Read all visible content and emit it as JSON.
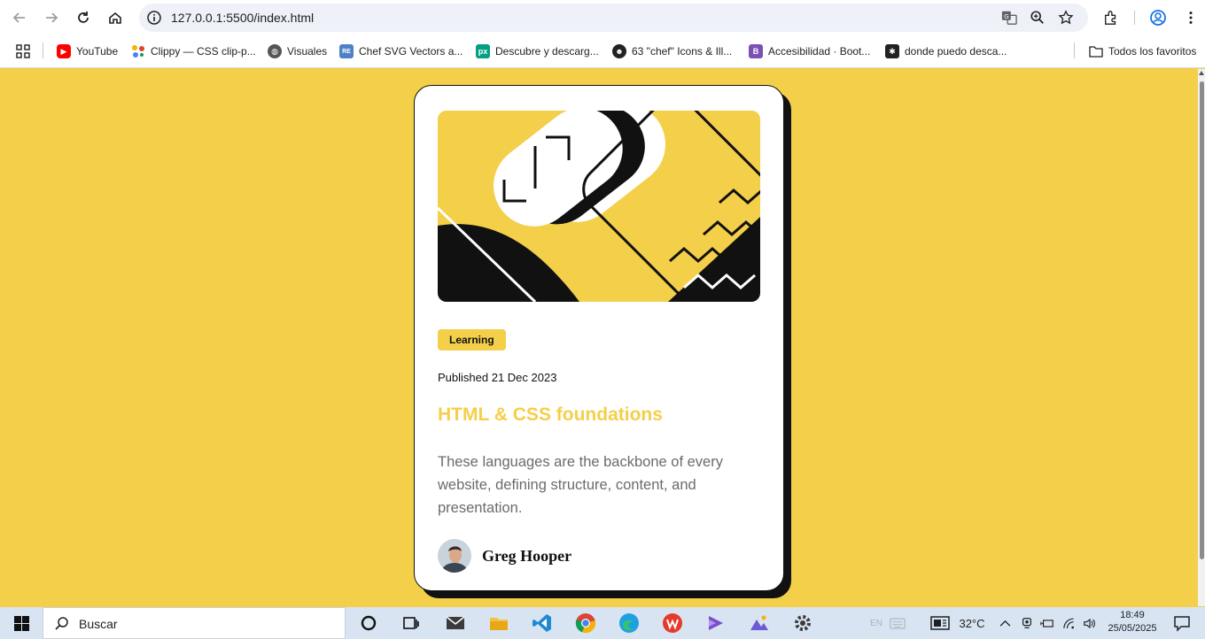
{
  "browser": {
    "url": "127.0.0.1:5500/index.html",
    "bookmarks": [
      {
        "label": "YouTube",
        "color": "#ff0000",
        "icon": "youtube-icon"
      },
      {
        "label": "Clippy — CSS clip-p...",
        "color": "#e94e77",
        "icon": "clippy-icon"
      },
      {
        "label": "Visuales",
        "color": "#555555",
        "icon": "globe-icon"
      },
      {
        "label": "Chef SVG Vectors a...",
        "color": "#4f82c4",
        "icon": "svgrepo-icon"
      },
      {
        "label": "Descubre y descarg...",
        "color": "#05a081",
        "icon": "pexels-icon"
      },
      {
        "label": "63 \"chef\" Icons & Ill...",
        "color": "#222222",
        "icon": "chef-icon"
      },
      {
        "label": "Accesibilidad · Boot...",
        "color": "#7952b3",
        "icon": "bootstrap-icon"
      },
      {
        "label": "donde puedo desca...",
        "color": "#222222",
        "icon": "site-icon"
      }
    ],
    "all_bookmarks_label": "Todos los favoritos"
  },
  "card": {
    "tag": "Learning",
    "published": "Published 21 Dec 2023",
    "title": "HTML & CSS foundations",
    "description": "These languages are the backbone of every website, defining structure, content, and presentation.",
    "author": "Greg Hooper",
    "accent_color": "#f4cf4a"
  },
  "taskbar": {
    "search_placeholder": "Buscar",
    "weather": "32°C",
    "time": "18:49",
    "date": "25/05/2025",
    "lang": "EN"
  }
}
